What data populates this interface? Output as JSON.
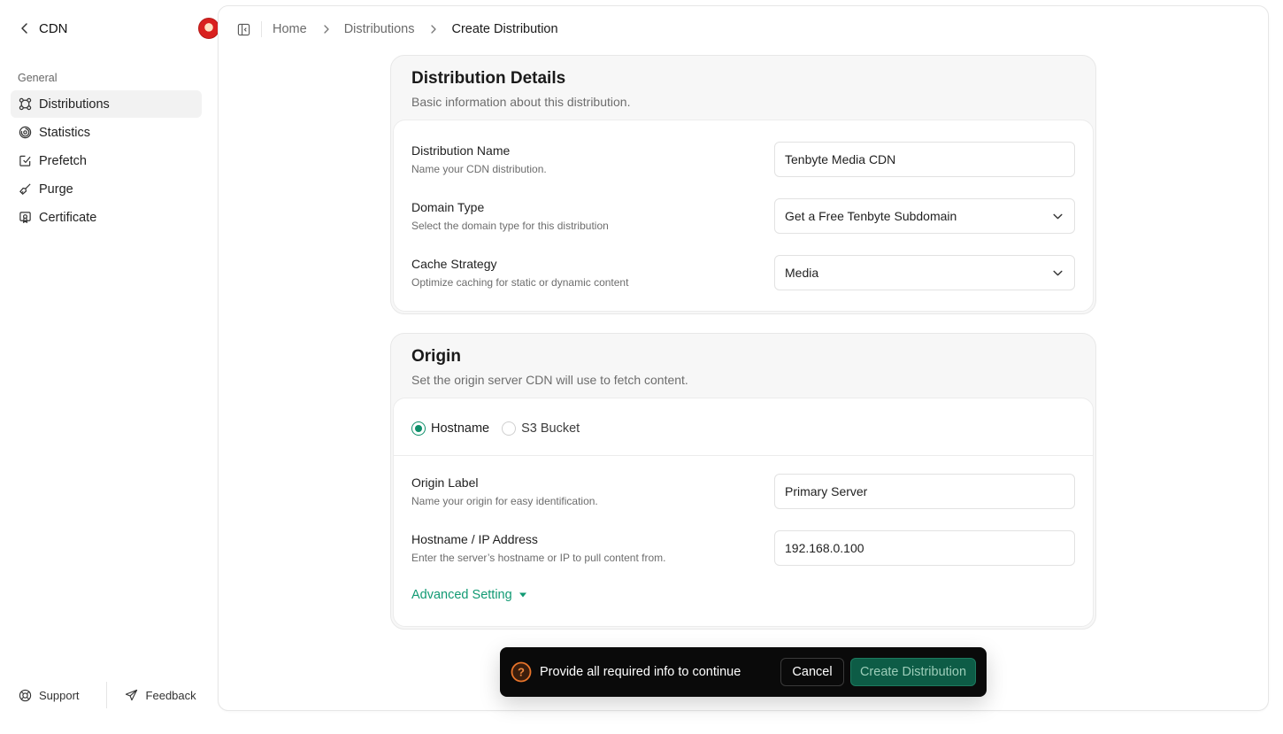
{
  "sidebar": {
    "title": "CDN",
    "section_label": "General",
    "items": [
      {
        "label": "Distributions",
        "icon": "distributions-icon",
        "active": true
      },
      {
        "label": "Statistics",
        "icon": "statistics-icon",
        "active": false
      },
      {
        "label": "Prefetch",
        "icon": "prefetch-icon",
        "active": false
      },
      {
        "label": "Purge",
        "icon": "purge-icon",
        "active": false
      },
      {
        "label": "Certificate",
        "icon": "certificate-icon",
        "active": false
      }
    ],
    "footer": {
      "support_label": "Support",
      "feedback_label": "Feedback"
    }
  },
  "breadcrumb": {
    "home": "Home",
    "distributions": "Distributions",
    "current": "Create Distribution"
  },
  "details_card": {
    "title": "Distribution Details",
    "subtitle": "Basic information about this distribution.",
    "fields": {
      "name": {
        "label": "Distribution Name",
        "help": "Name your CDN distribution.",
        "value": "Tenbyte Media CDN"
      },
      "domain_type": {
        "label": "Domain Type",
        "help": "Select the domain type for this distribution",
        "value": "Get a Free Tenbyte Subdomain"
      },
      "cache_strategy": {
        "label": "Cache Strategy",
        "help": "Optimize caching for static or dynamic content",
        "value": "Media"
      }
    }
  },
  "origin_card": {
    "title": "Origin",
    "subtitle": "Set the origin server CDN will use to fetch content.",
    "origin_types": [
      {
        "label": "Hostname",
        "selected": true
      },
      {
        "label": "S3 Bucket",
        "selected": false
      }
    ],
    "fields": {
      "label": {
        "label": "Origin Label",
        "help": "Name your origin for easy identification.",
        "value": "Primary Server"
      },
      "hostname": {
        "label": "Hostname / IP Address",
        "help": "Enter the server’s hostname or IP to pull content from.",
        "value": "192.168.0.100"
      }
    },
    "advanced_label": "Advanced Setting"
  },
  "toast": {
    "message": "Provide all required info to continue",
    "cancel_label": "Cancel",
    "create_label": "Create Distribution"
  },
  "colors": {
    "accent": "#119a73",
    "radio": "#0f8f6a",
    "warning": "#e8742a",
    "create_button": "#0d5c46"
  }
}
